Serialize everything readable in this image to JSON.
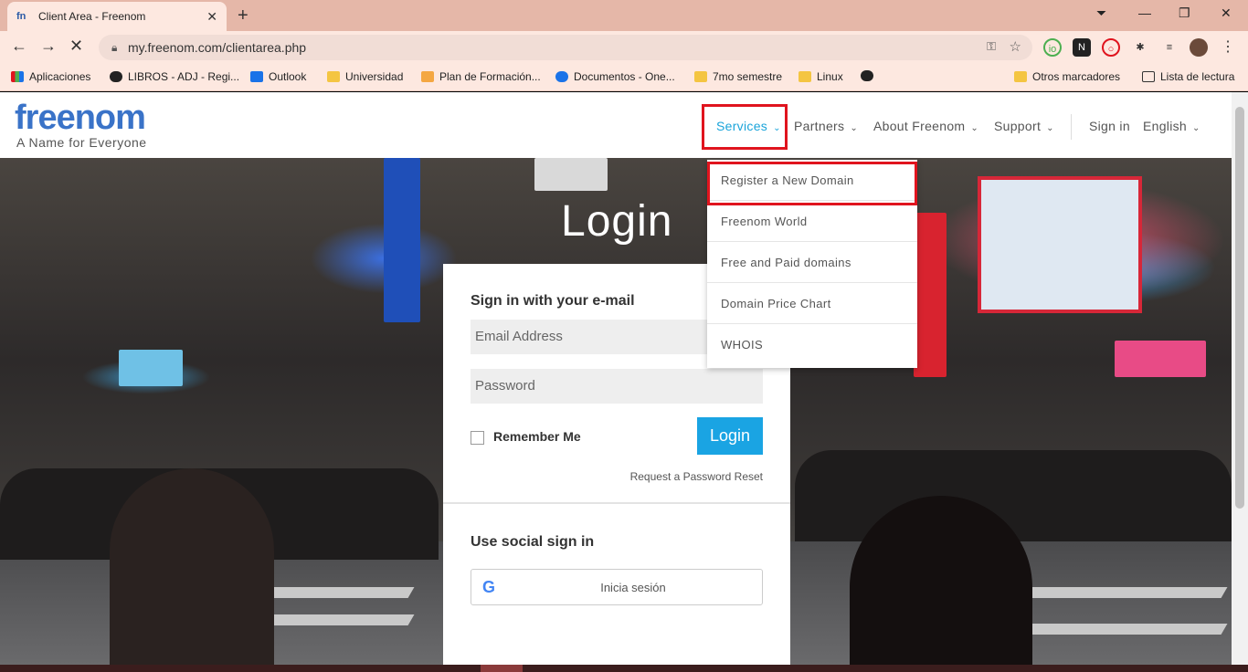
{
  "browser": {
    "tab_title": "Client Area - Freenom",
    "tab_favicon": "fn",
    "url": "my.freenom.com/clientarea.php"
  },
  "bookmarks": [
    {
      "label": "Aplicaciones",
      "icon": "apps-grid-icon"
    },
    {
      "label": "LIBROS - ADJ - Regi...",
      "icon": "globe-icon"
    },
    {
      "label": "Outlook",
      "icon": "outlook-icon"
    },
    {
      "label": "Universidad",
      "icon": "folder-icon"
    },
    {
      "label": "Plan de Formación...",
      "icon": "site-icon"
    },
    {
      "label": "Documentos - One...",
      "icon": "onedrive-icon"
    },
    {
      "label": "7mo semestre",
      "icon": "folder-icon"
    },
    {
      "label": "Linux",
      "icon": "folder-icon"
    },
    {
      "label": "",
      "icon": "globe-icon"
    },
    {
      "label": "Otros marcadores",
      "icon": "folder-icon"
    },
    {
      "label": "Lista de lectura",
      "icon": "reading-list-icon"
    }
  ],
  "site": {
    "logo": "freenom",
    "tagline": "A Name for Everyone",
    "nav": {
      "services": "Services",
      "partners": "Partners",
      "about": "About Freenom",
      "support": "Support",
      "signin": "Sign in",
      "language": "English"
    },
    "services_menu": [
      "Register a New Domain",
      "Freenom World",
      "Free and Paid domains",
      "Domain Price Chart",
      "WHOIS"
    ]
  },
  "login": {
    "title": "Login",
    "email_heading": "Sign in with your e-mail",
    "email_placeholder": "Email Address",
    "password_placeholder": "Password",
    "remember": "Remember Me",
    "login_button": "Login",
    "reset_link": "Request a Password Reset",
    "social_heading": "Use social sign in",
    "google_button": "Inicia sesión"
  },
  "colors": {
    "accent": "#1aa4e3",
    "highlight": "#e0141e",
    "tabbar": "#e5b7a8"
  }
}
